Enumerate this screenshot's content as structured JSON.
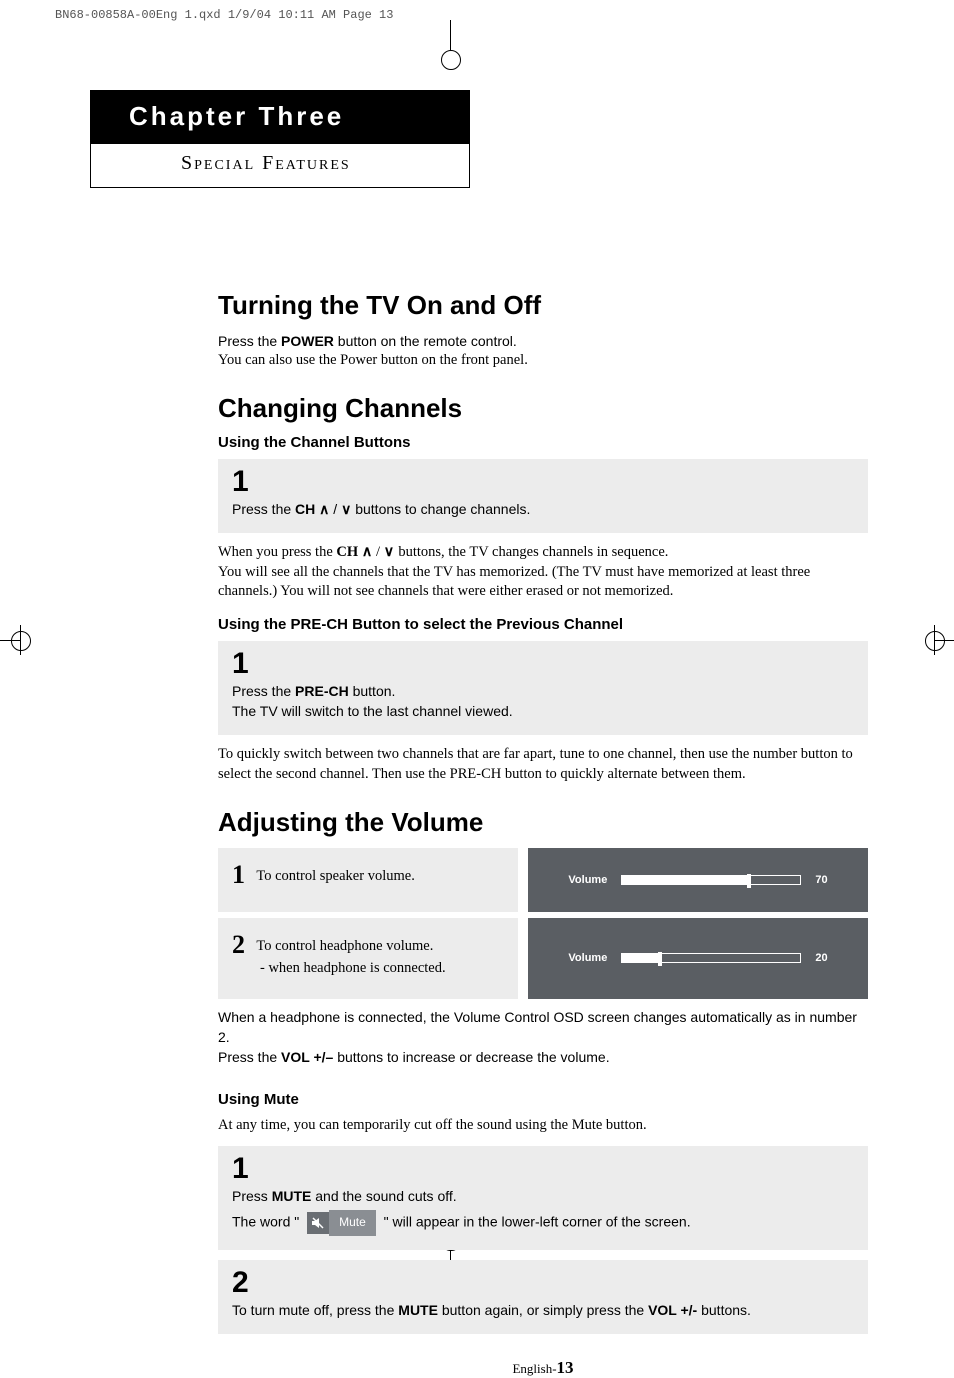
{
  "print_header": "BN68-00858A-00Eng 1.qxd  1/9/04 10:11 AM  Page 13",
  "chapter": {
    "title": "Chapter Three",
    "subtitle": "Special Features"
  },
  "sections": {
    "turning_on": {
      "heading": "Turning the TV On and Off",
      "line1_pre": "Press the ",
      "line1_bold": "POWER",
      "line1_post": " button on the remote control.",
      "line2": "You can also use the Power button on the front panel."
    },
    "changing": {
      "heading": "Changing Channels",
      "sub1": "Using the Channel Buttons",
      "step1_num": "1",
      "step1_pre": "Press the ",
      "step1_bold": "CH",
      "step1_post": " buttons to change channels.",
      "para1_pre": "When you press the ",
      "para1_bold": "CH",
      "para1_post": " buttons, the TV changes channels in sequence.",
      "para2": "You will see all the channels that the TV has memorized. (The TV must have  memorized at least three channels.) You will not see channels that were either erased or not memorized.",
      "sub2": "Using the PRE-CH Button to select the Previous Channel",
      "step2_num": "1",
      "step2a_pre": "Press the ",
      "step2a_bold": "PRE-CH",
      "step2a_post": " button.",
      "step2b": "The TV will switch to the last channel viewed.",
      "para3": "To quickly switch between two channels that are far apart, tune to one channel, then use the number button to select the second channel. Then use the PRE-CH button to quickly alternate between them."
    },
    "volume": {
      "heading": "Adjusting the Volume",
      "row1_num": "1",
      "row1_text": "To control speaker volume.",
      "row2_num": "2",
      "row2_text": "To control headphone volume.",
      "row2_sub": "- when headphone is connected.",
      "osd_label": "Volume",
      "osd_val1": "70",
      "osd_val2": "20",
      "note1": "When a headphone is connected, the Volume Control OSD screen changes automatically as in number 2.",
      "note2_pre": "Press the ",
      "note2_bold": "VOL +/–",
      "note2_post": " buttons to increase or decrease the volume."
    },
    "mute": {
      "heading": "Using Mute",
      "intro": "At any time, you can temporarily cut off the sound using the Mute button.",
      "step1_num": "1",
      "step1a_pre": "Press ",
      "step1a_bold": "MUTE",
      "step1a_post": " and the sound cuts off.",
      "step1b_pre": "The word ",
      "step1b_post": " will appear in the lower-left corner of the screen.",
      "badge_label": "Mute",
      "step2_num": "2",
      "step2_pre": "To turn mute off, press the ",
      "step2_bold1": "MUTE",
      "step2_mid": " button again, or simply press the ",
      "step2_bold2": "VOL +/-",
      "step2_post": " buttons."
    }
  },
  "footer": {
    "lang": "English-",
    "num": "13"
  }
}
